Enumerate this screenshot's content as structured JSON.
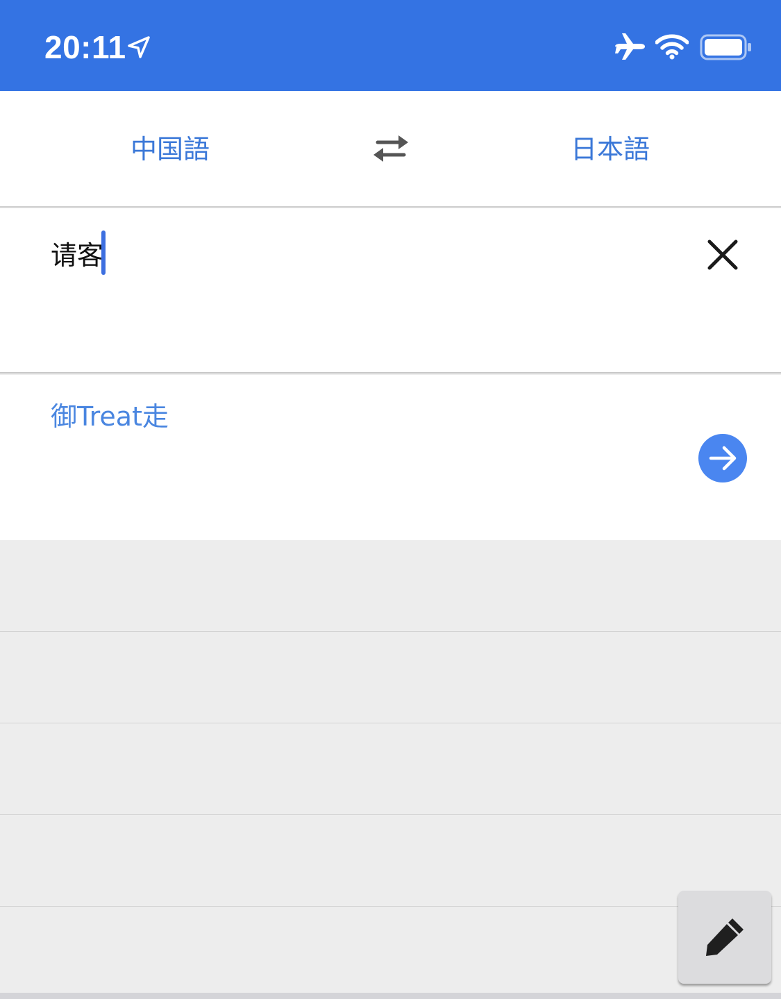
{
  "status_bar": {
    "time": "20:11",
    "icons": [
      "location-arrow-icon",
      "airplane-icon",
      "wifi-icon",
      "battery-icon"
    ],
    "background_color": "#3473e3"
  },
  "language_bar": {
    "source_language": "中国語",
    "target_language": "日本語",
    "swap_icon": "swap-arrows-icon",
    "accent_color": "#3b78d8"
  },
  "input": {
    "text": "请客",
    "clear_icon": "close-icon",
    "caret_color": "#3d6fe0"
  },
  "result": {
    "translation": "御Treat走",
    "go_icon": "arrow-right-circle-icon",
    "go_color": "#4a86f0"
  },
  "history": {
    "rows": 5
  },
  "handwriting": {
    "icon": "pen-icon"
  }
}
